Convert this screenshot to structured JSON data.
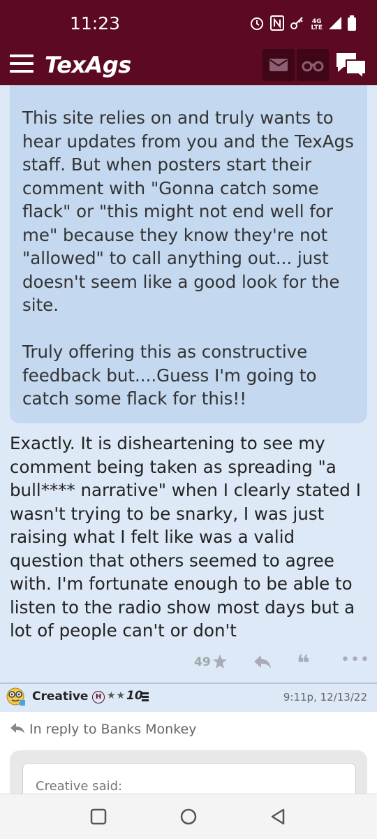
{
  "status": {
    "time": "11:23",
    "network": "4G\nLTE"
  },
  "header": {
    "logo": "TexAgs",
    "icons": [
      "menu-icon",
      "mail-icon",
      "binoculars-icon",
      "chat-icon"
    ]
  },
  "quoted_post": {
    "text": "This site relies on and truly wants to hear updates from you and the TexAgs staff. But when posters start their comment with \"Gonna catch some flack\" or \"this might not end well for me\" because they know they're not \"allowed\" to call anything out... just doesn't seem like a good look for the site.\n\nTruly offering this as constructive feedback but....Guess I'm going to catch some flack for this!!"
  },
  "post": {
    "body": "Exactly. It is disheartening to see my comment being taken as spreading \"a bull**** narrative\" when I clearly stated I wasn't trying to be snarky, I was just raising what I felt like was a valid question that others seemed to agree with. I'm fortunate enough to be able to listen to the radio show most days but a lot of people can't or don't",
    "like_count": "49"
  },
  "next_post": {
    "username": "Creative",
    "badge": "H",
    "stars": "★★",
    "rank": "10",
    "timestamp": "9:11p, 12/13/22",
    "reply_to": "In reply to Banks Monkey",
    "quote_label": "Creative said:"
  },
  "colors": {
    "maroon": "#5c0a22",
    "page_bg": "#dde9f7",
    "quote_bg": "#c4d8f0"
  }
}
